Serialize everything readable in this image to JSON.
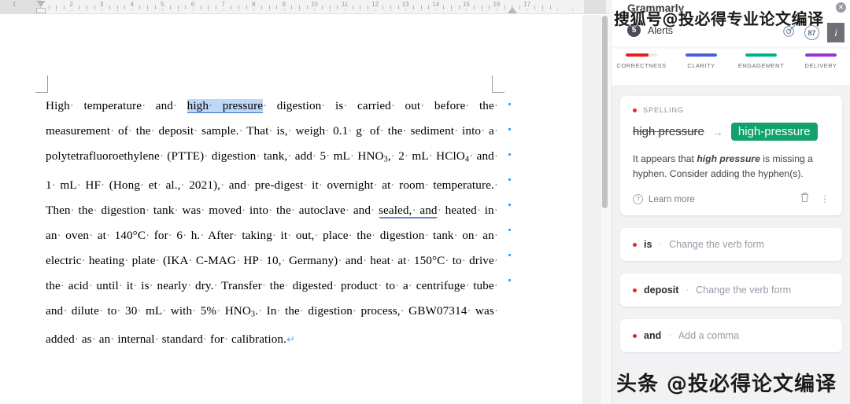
{
  "document": {
    "ruler": {
      "numbers": [
        1,
        1,
        2,
        3,
        4,
        5,
        6,
        7,
        8,
        9,
        10,
        11,
        12,
        13,
        14,
        15,
        16,
        17
      ]
    },
    "paragraph_runs": [
      {
        "t": "High temperature and ",
        "s": "plain"
      },
      {
        "t": "high pressure",
        "s": "selected"
      },
      {
        "t": " digestion is carried out before the measurement of the deposit sample. That is, weigh 0.1 g of the sediment into a polytetrafluoroethylene (PTTE) digestion tank, add 5 mL HNO",
        "s": "plain"
      },
      {
        "t": "3",
        "s": "sub"
      },
      {
        "t": ", 2 mL HClO",
        "s": "plain"
      },
      {
        "t": "4",
        "s": "sub"
      },
      {
        "t": " and 1 mL HF (Hong et al., 2021), and pre-digest it overnight at room temperature. Then the digestion tank was moved into the autoclave and ",
        "s": "plain"
      },
      {
        "t": "sealed, and",
        "s": "underlined"
      },
      {
        "t": " heated in an oven at 140°C for 6 h. After taking it out, place the digestion tank on an electric heating plate (IKA C-MAG HP 10, Germany) and heat at 150°C to drive the acid until it is nearly dry. Transfer the digested product to a centrifuge tube and dilute to 30 mL with 5% HNO",
        "s": "plain"
      },
      {
        "t": "3",
        "s": "sub"
      },
      {
        "t": ". In the digestion process, GBW07314 was added as an internal standard for calibration.",
        "s": "plain"
      },
      {
        "t": "↵",
        "s": "pilcrow"
      }
    ]
  },
  "panel": {
    "brand": "Grammarly",
    "alerts_count": "5",
    "alerts_label": "Alerts",
    "score": "87",
    "info_label": "i",
    "close_label": "✕",
    "categories": [
      {
        "label": "CORRECTNESS",
        "color": "#ec1c24",
        "fill": 72
      },
      {
        "label": "CLARITY",
        "color": "#4a5ce0",
        "fill": 100
      },
      {
        "label": "ENGAGEMENT",
        "color": "#00b386",
        "fill": 100
      },
      {
        "label": "DELIVERY",
        "color": "#9b30d9",
        "fill": 100
      }
    ],
    "card": {
      "kind": "SPELLING",
      "old_word": "high pressure",
      "arrow": "→",
      "new_word": "high-pressure",
      "explain_pre": "It appears that ",
      "explain_bold": "high pressure",
      "explain_post": " is missing a hyphen. Consider adding the hyphen(s).",
      "learn_more": "Learn more",
      "help_glyph": "?",
      "trash_glyph": "🗑",
      "kebab_glyph": "⋮"
    },
    "suggestions": [
      {
        "word": "is",
        "sep": "·",
        "action": "Change the verb form"
      },
      {
        "word": "deposit",
        "sep": "·",
        "action": "Change the verb form"
      },
      {
        "word": "and",
        "sep": "·",
        "action": "Add a comma"
      }
    ]
  },
  "watermarks": {
    "top": "搜狐号@投必得专业论文编译",
    "bottom": "头条 @投必得论文编译"
  }
}
